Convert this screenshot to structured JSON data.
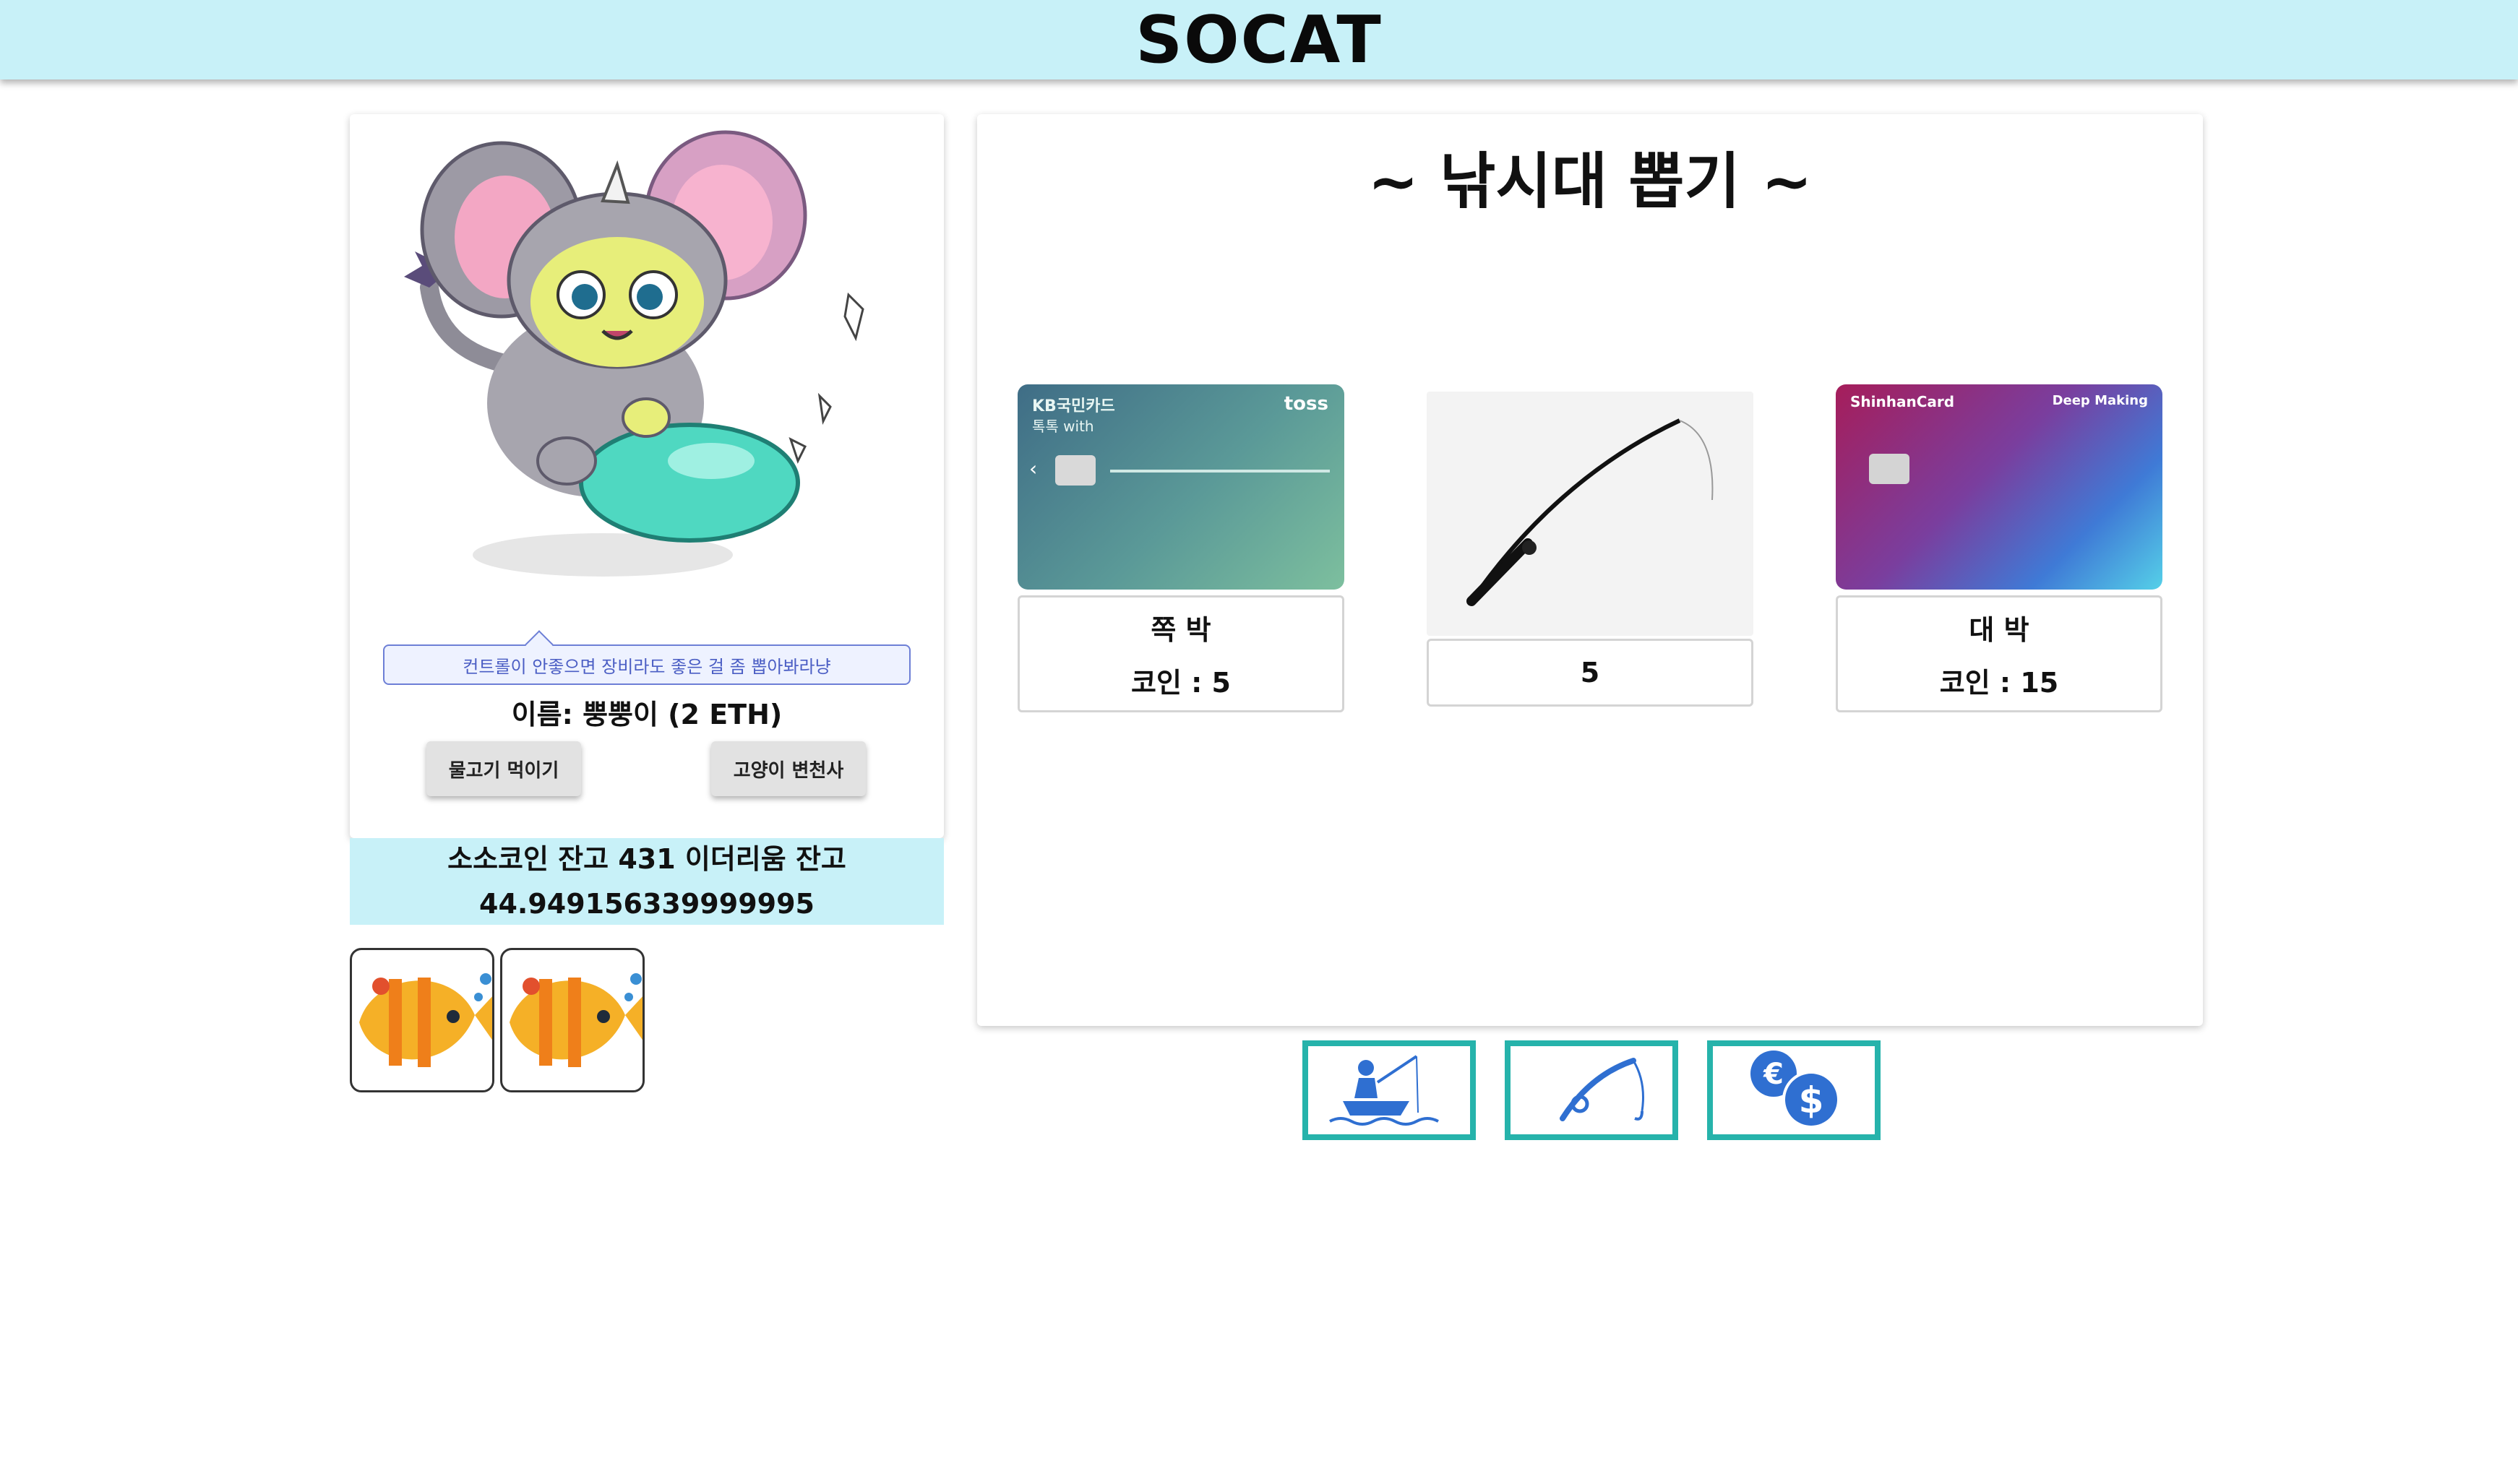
{
  "app": {
    "title": "SOCAT"
  },
  "cat": {
    "tip": "컨트롤이 안좋으면 장비라도 좋은 걸 좀 뽑아봐라냥",
    "name": "이름: 뿡뿡이 (2 ETH)",
    "feed_button": "물고기 먹이기",
    "angel_button": "고양이 변천사"
  },
  "balance": {
    "line1": "소소코인 잔고 431 이더리움 잔고",
    "line2": "44.949156339999995"
  },
  "inventory": {
    "fish": [
      "fish-icon",
      "fish-icon"
    ]
  },
  "gacha": {
    "title": "~ 낚시대 뽑기 ~",
    "left_card": {
      "brand": "KB국민카드",
      "brand2": "toss",
      "product": "톡톡 with",
      "result": "쪽 박",
      "coin": "코인 : 5"
    },
    "center": {
      "value": "5"
    },
    "right_card": {
      "brand": "ShinhanCard",
      "product": "Deep Making",
      "result": "대 박",
      "coin": "코인 : 15"
    }
  },
  "actions": [
    {
      "icon": "fishing-boat-icon"
    },
    {
      "icon": "fishing-rod-icon"
    },
    {
      "icon": "currency-exchange-icon"
    }
  ],
  "colors": {
    "header_bg": "#c8f1f8",
    "accent_teal": "#26b3ab",
    "icon_blue": "#2f6fd1",
    "tip_border": "#6d7fd6"
  }
}
